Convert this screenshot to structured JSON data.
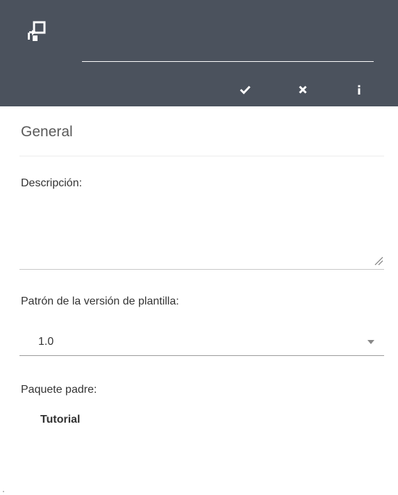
{
  "header": {
    "icon": "template-insert-icon",
    "name_value": "",
    "toolbar": [
      {
        "name": "confirm",
        "icon": "check-icon"
      },
      {
        "name": "cancel",
        "icon": "close-icon"
      },
      {
        "name": "info",
        "icon": "info-icon"
      }
    ],
    "background": "#4b525d"
  },
  "section": {
    "title": "General"
  },
  "description": {
    "label": "Descripción:",
    "value": ""
  },
  "template_version": {
    "label": "Patrón de la versión de plantilla:",
    "selected": "1.0"
  },
  "parent_package": {
    "label": "Paquete padre:",
    "value": "Tutorial"
  }
}
